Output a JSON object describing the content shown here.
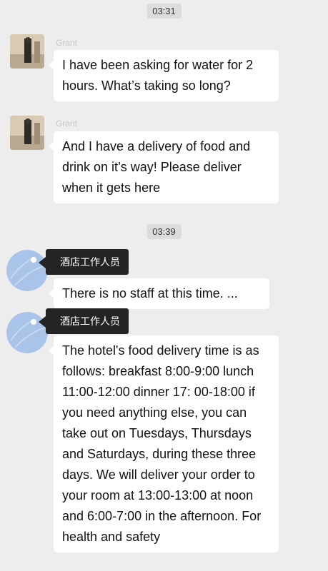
{
  "messages": [
    {
      "type": "time",
      "text": "03:31"
    },
    {
      "type": "msg",
      "sender": "Grant",
      "text": "I have been asking for water for 2 hours. What’s taking so long?"
    },
    {
      "type": "msg",
      "sender": "Grant",
      "text": "And I have a delivery of food and drink on it’s way! Please deliver when it gets here"
    },
    {
      "type": "time",
      "text": "03:39"
    },
    {
      "type": "msg",
      "sender": "酒店工作人员",
      "text": "There is no staff at this time. ..."
    },
    {
      "type": "msg",
      "sender": "酒店工作人员",
      "text": "The hotel's food delivery time is as follows: breakfast 8:00-9:00 lunch 11:00-12:00 dinner 17: 00-18:00 if you need anything else, you can take out on Tuesdays, Thursdays and Saturdays, during these three days. We will deliver your order to your room at 13:00-13:00 at noon and 6:00-7:00 in the afternoon. For health and safety"
    }
  ]
}
